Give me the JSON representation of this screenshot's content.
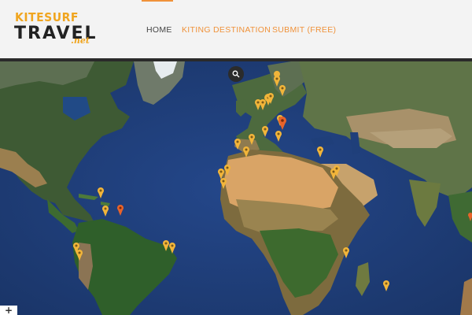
{
  "logo": {
    "top": "KITESURF",
    "main": "TRAVEL",
    "suffix": ".net"
  },
  "nav": {
    "home": "HOME",
    "destinations": "KITING DESTINATION",
    "submit": "SUBMIT (FREE)"
  },
  "map": {
    "search_icon": "search-icon",
    "zoom_in": "+",
    "colors": {
      "pin_default": "#f2b53a",
      "pin_highlight": "#e8632a",
      "ocean": "#1f3f7a",
      "accent": "#f0923a"
    }
  }
}
